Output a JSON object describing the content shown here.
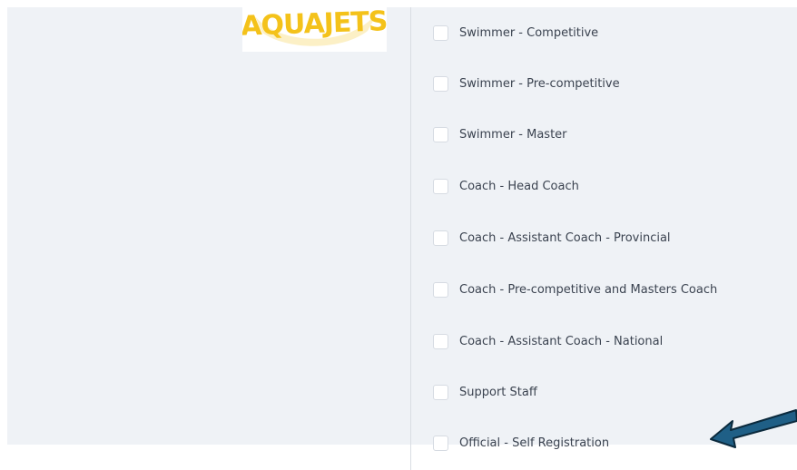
{
  "logo": {
    "text": "AQUAJETS",
    "color": "#f4c21a"
  },
  "roles": [
    {
      "label": "Swimmer - Competitive",
      "checked": false
    },
    {
      "label": "Swimmer - Pre-competitive",
      "checked": false
    },
    {
      "label": "Swimmer - Master",
      "checked": false
    },
    {
      "label": "Coach - Head Coach",
      "checked": false
    },
    {
      "label": "Coach - Assistant Coach - Provincial",
      "checked": false
    },
    {
      "label": "Coach - Pre-competitive and Masters Coach",
      "checked": false
    },
    {
      "label": "Coach - Assistant Coach - National",
      "checked": false
    },
    {
      "label": "Support Staff",
      "checked": false
    },
    {
      "label": "Official - Self Registration",
      "checked": false
    }
  ],
  "colors": {
    "background": "#eff2f6",
    "text": "#3b4350",
    "checkbox_border": "#d6dbe2",
    "arrow_fill": "#1f5f86",
    "arrow_stroke": "#0b2a3d"
  },
  "annotation": {
    "type": "arrow",
    "points_to": "Official - Self Registration"
  }
}
